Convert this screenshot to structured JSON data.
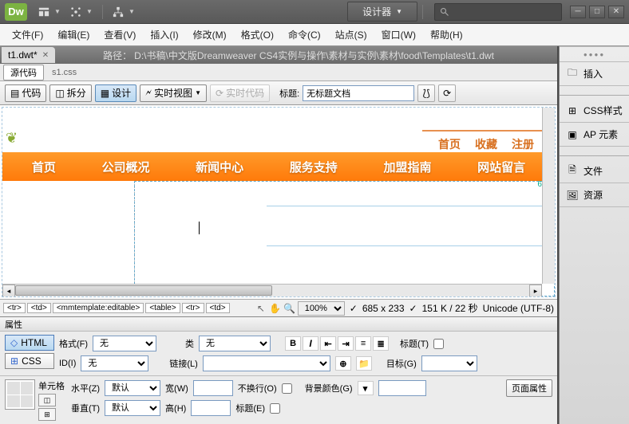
{
  "app": {
    "logo": "Dw",
    "designer_label": "设计器",
    "search_placeholder": ""
  },
  "menu": {
    "file": "文件(F)",
    "edit": "编辑(E)",
    "view": "查看(V)",
    "insert": "插入(I)",
    "modify": "修改(M)",
    "format": "格式(O)",
    "commands": "命令(C)",
    "site": "站点(S)",
    "window": "窗口(W)",
    "help": "帮助(H)"
  },
  "tabs": {
    "filename": "t1.dwt*",
    "path_label": "路径：",
    "path": "D:\\书稿\\中文版Dreamweaver CS4实例与操作\\素材与实例\\素材\\food\\Templates\\t1.dwt"
  },
  "source": {
    "tab": "源代码",
    "css": "s1.css"
  },
  "toolbar": {
    "code": "代码",
    "split": "拆分",
    "design": "设计",
    "live_view": "实时视图",
    "live_code": "实时代码",
    "title_label": "标题:",
    "title_value": "无标题文档"
  },
  "canvas": {
    "nav_top": {
      "home": "首页",
      "favorite": "收藏",
      "register": "注册"
    },
    "nav_main": {
      "home": "首页",
      "company": "公司概况",
      "news": "新闻中心",
      "service": "服务支持",
      "franchise": "加盟指南",
      "message": "网站留言"
    },
    "region_size": "666"
  },
  "status": {
    "tags": [
      "<tr>",
      "<td>",
      "<mmtemplate:editable>",
      "<table>",
      "<tr>",
      "<td>"
    ],
    "zoom": "100%",
    "dims": "685 x 233",
    "size": "151 K / 22 秒",
    "encoding": "Unicode (UTF-8)"
  },
  "props": {
    "title": "属性",
    "html_btn": "HTML",
    "css_btn": "CSS",
    "format_label": "格式(F)",
    "format_val": "无",
    "id_label": "ID(I)",
    "id_val": "无",
    "class_label": "类",
    "class_val": "无",
    "link_label": "链接(L)",
    "heading_label": "标题(T)",
    "target_label": "目标(G)",
    "cell_label": "单元格",
    "horiz_label": "水平(Z)",
    "horiz_val": "默认",
    "vert_label": "垂直(T)",
    "vert_val": "默认",
    "width_label": "宽(W)",
    "height_label": "高(H)",
    "nowrap_label": "不换行(O)",
    "header_label": "标题(E)",
    "bg_label": "背景颜色(G)",
    "page_props": "页面属性"
  },
  "panels": {
    "insert": "插入",
    "css": "CSS样式",
    "ap": "AP 元素",
    "files": "文件",
    "assets": "资源"
  }
}
